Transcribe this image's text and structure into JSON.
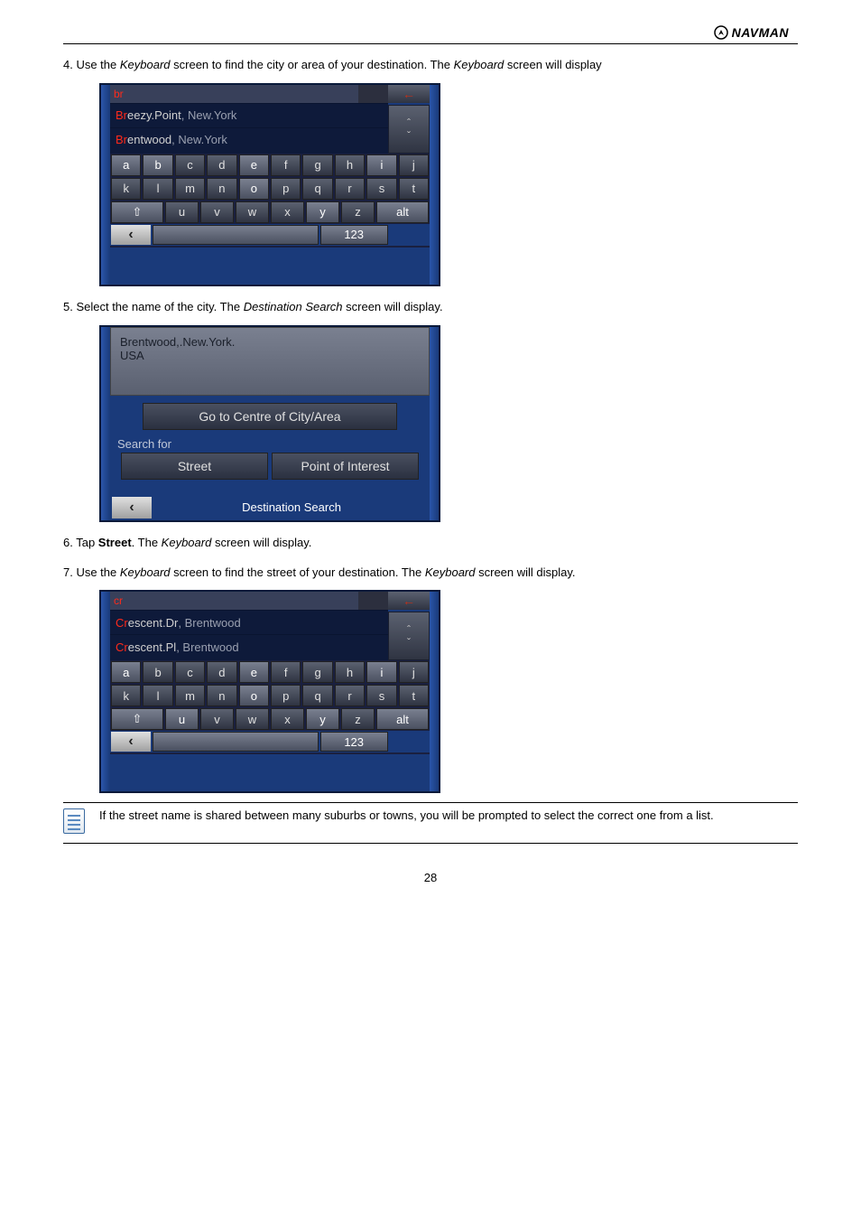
{
  "brand": "NAVMAN",
  "pagenum": "28",
  "step4": {
    "leadin": "4.  Use the ",
    "kw": "Keyboard",
    "mid": " screen to find the city or area of your destination. The ",
    "kw2": "Keyboard",
    "trail": " screen will display"
  },
  "screenshot1": {
    "query": "br",
    "suggest": [
      {
        "match": "Br",
        "rest": "eezy.Point",
        "sub": ", New.York"
      },
      {
        "match": "Br",
        "rest": "entwood",
        "sub": ", New.York"
      }
    ],
    "row1": [
      "a",
      "b",
      "c",
      "d",
      "e",
      "f",
      "g",
      "h",
      "i",
      "j"
    ],
    "row2": [
      "k",
      "l",
      "m",
      "n",
      "o",
      "p",
      "q",
      "r",
      "s",
      "t"
    ],
    "row3_special": "⇧",
    "row3": [
      "u",
      "v",
      "w",
      "x",
      "y",
      "z"
    ],
    "alt": "alt",
    "num": "123"
  },
  "step5": {
    "leadin": "5.  Select the name of the city. The ",
    "kw": "Destination Search",
    "trail": " screen will display."
  },
  "screenshot2": {
    "location_line1": "Brentwood,.New.York.",
    "location_line2": "USA",
    "go_centre": "Go to Centre of City/Area",
    "search_for": "Search for",
    "street_btn": "Street",
    "poi_btn": "Point of Interest",
    "footer_title": "Destination Search"
  },
  "step6": {
    "leadin": "6.  Tap ",
    "kw": "Street",
    "mid1": ". The ",
    "kw2": "Keyboard",
    "trail1": " screen will display.",
    "leadin2": "7.  Use the ",
    "kw3": "Keyboard",
    "mid2": " screen to find the street of your destination. The ",
    "kw4": "Keyboard",
    "trail2": " screen will display."
  },
  "screenshot3": {
    "query": "cr",
    "suggest": [
      {
        "match": "Cr",
        "rest": "escent.Dr",
        "sub": ", Brentwood"
      },
      {
        "match": "Cr",
        "rest": "escent.Pl",
        "sub": ", Brentwood"
      }
    ],
    "row1": [
      "a",
      "b",
      "c",
      "d",
      "e",
      "f",
      "g",
      "h",
      "i",
      "j"
    ],
    "row2": [
      "k",
      "l",
      "m",
      "n",
      "o",
      "p",
      "q",
      "r",
      "s",
      "t"
    ],
    "row3_special": "⇧",
    "row3": [
      "u",
      "v",
      "w",
      "x",
      "y",
      "z"
    ],
    "alt": "alt",
    "num": "123"
  },
  "note": "If the street name is shared between many suburbs or towns, you will be prompted to select the correct one from a list.",
  "chart_data": null
}
